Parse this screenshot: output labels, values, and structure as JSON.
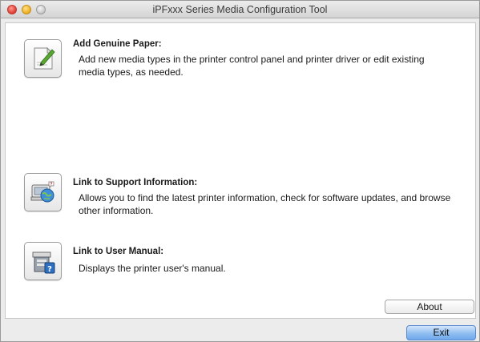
{
  "window": {
    "title": "iPFxxx Series Media Configuration Tool"
  },
  "items": [
    {
      "icon": "paper-edit-icon",
      "title": "Add Genuine Paper:",
      "description": "Add new media types in the printer control panel and printer driver or edit existing media types, as needed."
    },
    {
      "icon": "support-globe-icon",
      "title": "Link to Support Information:",
      "description": "Allows you to find the latest printer information, check for software updates, and browse other information."
    },
    {
      "icon": "user-manual-icon",
      "title": "Link to User Manual:",
      "description": "Displays the printer user's manual."
    }
  ],
  "buttons": {
    "about": "About",
    "exit": "Exit"
  },
  "colors": {
    "window_bg": "#ececec",
    "content_bg": "#ffffff",
    "default_button": "#6fa8ec",
    "close": "#e2463c",
    "minimize": "#f0b42a"
  }
}
